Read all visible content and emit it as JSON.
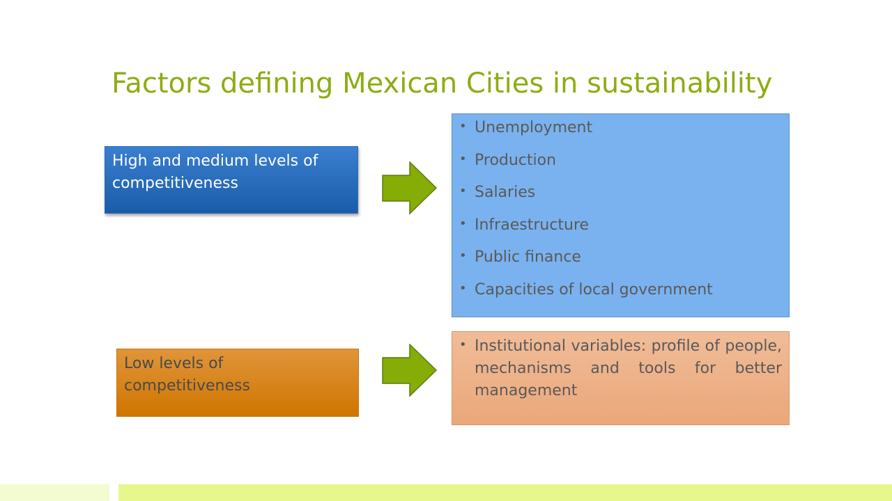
{
  "title": "Factors defining Mexican Cities in sustainability",
  "high_group": {
    "label": "High and medium levels of competitiveness",
    "factors": [
      "Unemployment",
      "Production",
      "Salaries",
      "Infraestructure",
      "Public finance",
      "Capacities of local government"
    ]
  },
  "low_group": {
    "label": "Low levels of competitiveness",
    "factors": [
      "Institutional variables: profile of people, mechanisms and tools for better management"
    ]
  },
  "colors": {
    "title": "#8bad14",
    "high_box_top": "#3a7fd0",
    "high_box_bottom": "#1a5ca8",
    "high_list_bg": "#7ab2ef",
    "low_box_top": "#e0953a",
    "low_box_bottom": "#cf7500",
    "low_label_text": "#4a4a4a",
    "low_list_top": "#f0bc98",
    "low_list_bottom": "#eba77a",
    "arrow_fill": "#86ac06",
    "arrow_stroke": "#5d7a14",
    "bar_left": "#f3fbd1",
    "bar_right": "#e7f78c"
  },
  "icons": {
    "arrow": "right-arrow-icon"
  }
}
